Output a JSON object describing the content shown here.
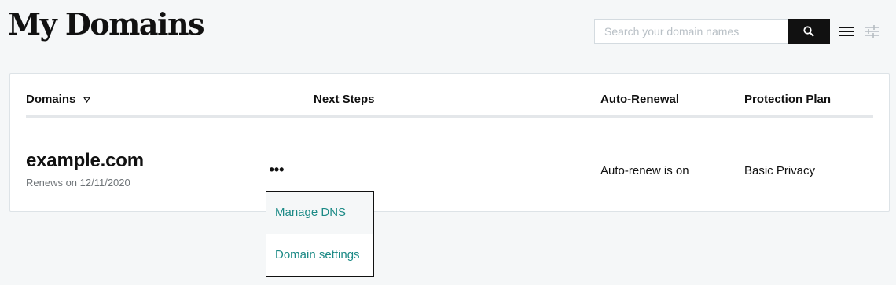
{
  "page": {
    "title": "My Domains"
  },
  "search": {
    "placeholder": "Search your domain names",
    "value": ""
  },
  "table": {
    "columns": {
      "domains": "Domains",
      "next_steps": "Next Steps",
      "auto_renewal": "Auto-Renewal",
      "protection_plan": "Protection Plan"
    },
    "sort_indicator": "▿",
    "rows": [
      {
        "domain": "example.com",
        "renews": "Renews on 12/11/2020",
        "more_label": "•••",
        "auto_renewal": "Auto-renew is on",
        "protection_plan": "Basic Privacy"
      }
    ]
  },
  "menu": {
    "items": [
      {
        "label": "Manage DNS"
      },
      {
        "label": "Domain settings"
      }
    ]
  },
  "colors": {
    "accent": "#1c8a86",
    "search_button": "#111111",
    "background": "#f5f7f8"
  },
  "icons": {
    "search": "search-icon",
    "list_view": "hamburger-icon",
    "filters": "sliders-icon",
    "sort": "sort-triangle-icon"
  }
}
